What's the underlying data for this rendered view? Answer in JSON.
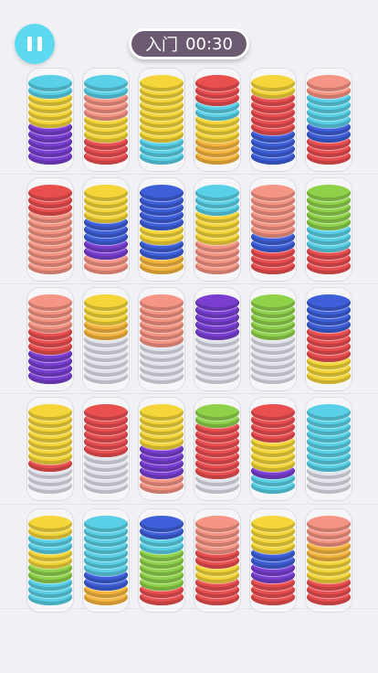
{
  "hud": {
    "pause_icon": "pause-icon",
    "level_label": "入门",
    "timer": "00:30"
  },
  "colors": {
    "P": "#7a3fd0",
    "Y": "#f4d63a",
    "R": "#e94f4f",
    "S": "#f59585",
    "C": "#5ad0e8",
    "B": "#3e5fd8",
    "G": "#8fd24a",
    "O": "#f6b63e",
    "E": "#e3e3ec"
  },
  "rows": [
    [
      [
        "P",
        "P",
        "P",
        "P",
        "P",
        "Y",
        "Y",
        "Y",
        "Y",
        "C",
        "C"
      ],
      [
        "R",
        "R",
        "R",
        "Y",
        "Y",
        "Y",
        "S",
        "S",
        "S",
        "C",
        "C"
      ],
      [
        "C",
        "C",
        "C",
        "Y",
        "Y",
        "Y",
        "Y",
        "Y",
        "Y",
        "Y",
        "Y"
      ],
      [
        "O",
        "O",
        "O",
        "Y",
        "Y",
        "Y",
        "C",
        "C",
        "R",
        "R",
        "R"
      ],
      [
        "B",
        "B",
        "B",
        "B",
        "R",
        "R",
        "R",
        "R",
        "R",
        "Y",
        "Y"
      ],
      [
        "R",
        "R",
        "R",
        "B",
        "B",
        "C",
        "C",
        "C",
        "C",
        "S",
        "S"
      ]
    ],
    [
      [
        "S",
        "S",
        "S",
        "S",
        "S",
        "S",
        "S",
        "S",
        "R",
        "R",
        "R"
      ],
      [
        "S",
        "S",
        "P",
        "P",
        "B",
        "B",
        "B",
        "Y",
        "Y",
        "Y",
        "Y"
      ],
      [
        "O",
        "O",
        "B",
        "B",
        "Y",
        "Y",
        "B",
        "B",
        "B",
        "B",
        "B"
      ],
      [
        "S",
        "S",
        "S",
        "S",
        "Y",
        "Y",
        "Y",
        "Y",
        "C",
        "C",
        "C"
      ],
      [
        "R",
        "R",
        "R",
        "B",
        "B",
        "S",
        "S",
        "S",
        "S",
        "S",
        "S"
      ],
      [
        "R",
        "R",
        "R",
        "C",
        "C",
        "C",
        "G",
        "G",
        "G",
        "G",
        "G"
      ]
    ],
    [
      [
        "P",
        "P",
        "P",
        "P",
        "R",
        "R",
        "R",
        "S",
        "S",
        "S",
        "S"
      ],
      [
        "E",
        "E",
        "E",
        "E",
        "E",
        "E",
        "O",
        "O",
        "Y",
        "Y",
        "Y"
      ],
      [
        "E",
        "E",
        "E",
        "E",
        "E",
        "S",
        "S",
        "S",
        "S",
        "S",
        "S"
      ],
      [
        "E",
        "E",
        "E",
        "E",
        "E",
        "E",
        "P",
        "P",
        "P",
        "P",
        "P"
      ],
      [
        "E",
        "E",
        "E",
        "E",
        "E",
        "E",
        "G",
        "G",
        "G",
        "G",
        "G"
      ],
      [
        "Y",
        "Y",
        "Y",
        "R",
        "R",
        "R",
        "R",
        "B",
        "B",
        "B",
        "B"
      ]
    ],
    [
      [
        "E",
        "E",
        "E",
        "R",
        "Y",
        "Y",
        "Y",
        "Y",
        "Y",
        "Y",
        "Y"
      ],
      [
        "E",
        "E",
        "E",
        "E",
        "E",
        "R",
        "R",
        "R",
        "R",
        "R",
        "R"
      ],
      [
        "S",
        "S",
        "P",
        "P",
        "P",
        "P",
        "Y",
        "Y",
        "Y",
        "Y",
        "Y"
      ],
      [
        "E",
        "E",
        "R",
        "R",
        "R",
        "R",
        "R",
        "R",
        "R",
        "G",
        "G"
      ],
      [
        "C",
        "C",
        "P",
        "Y",
        "Y",
        "Y",
        "Y",
        "R",
        "R",
        "R",
        "R"
      ],
      [
        "E",
        "E",
        "E",
        "C",
        "C",
        "C",
        "C",
        "C",
        "C",
        "C",
        "C"
      ]
    ],
    [
      [
        "C",
        "C",
        "C",
        "G",
        "G",
        "Y",
        "Y",
        "C",
        "C",
        "Y",
        "Y"
      ],
      [
        "O",
        "O",
        "B",
        "B",
        "C",
        "C",
        "C",
        "C",
        "C",
        "C",
        "C"
      ],
      [
        "R",
        "R",
        "G",
        "G",
        "G",
        "G",
        "G",
        "C",
        "C",
        "B",
        "B"
      ],
      [
        "R",
        "R",
        "R",
        "Y",
        "Y",
        "R",
        "R",
        "S",
        "S",
        "S",
        "S"
      ],
      [
        "R",
        "R",
        "R",
        "P",
        "P",
        "B",
        "B",
        "Y",
        "Y",
        "Y",
        "Y"
      ],
      [
        "R",
        "R",
        "R",
        "Y",
        "Y",
        "Y",
        "O",
        "O",
        "S",
        "S",
        "S"
      ]
    ]
  ]
}
